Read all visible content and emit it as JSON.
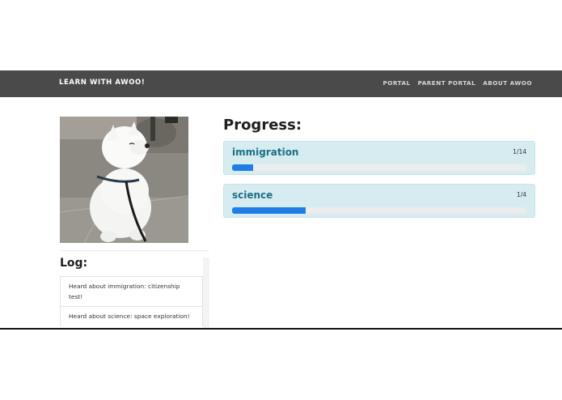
{
  "header": {
    "brand": "LEARN WITH AWOO!",
    "nav": [
      "PORTAL",
      "PARENT PORTAL",
      "ABOUT AWOO"
    ]
  },
  "sidebar": {
    "photo_alt": "white samoyed dog on a leash",
    "log_title": "Log:",
    "log_items": [
      "Heard about immigration: citizenship test!",
      "Heard about science: space exploration!"
    ]
  },
  "progress": {
    "title": "Progress:",
    "subjects": [
      {
        "name": "immigration",
        "count": "1/14",
        "fraction": 0.0714
      },
      {
        "name": "science",
        "count": "1/4",
        "fraction": 0.25
      }
    ]
  },
  "colors": {
    "topbar": "#4a4a4a",
    "card_bg": "#d6ecf1",
    "subject_text": "#1a6f83",
    "bar_fill": "#1e7ee6"
  }
}
